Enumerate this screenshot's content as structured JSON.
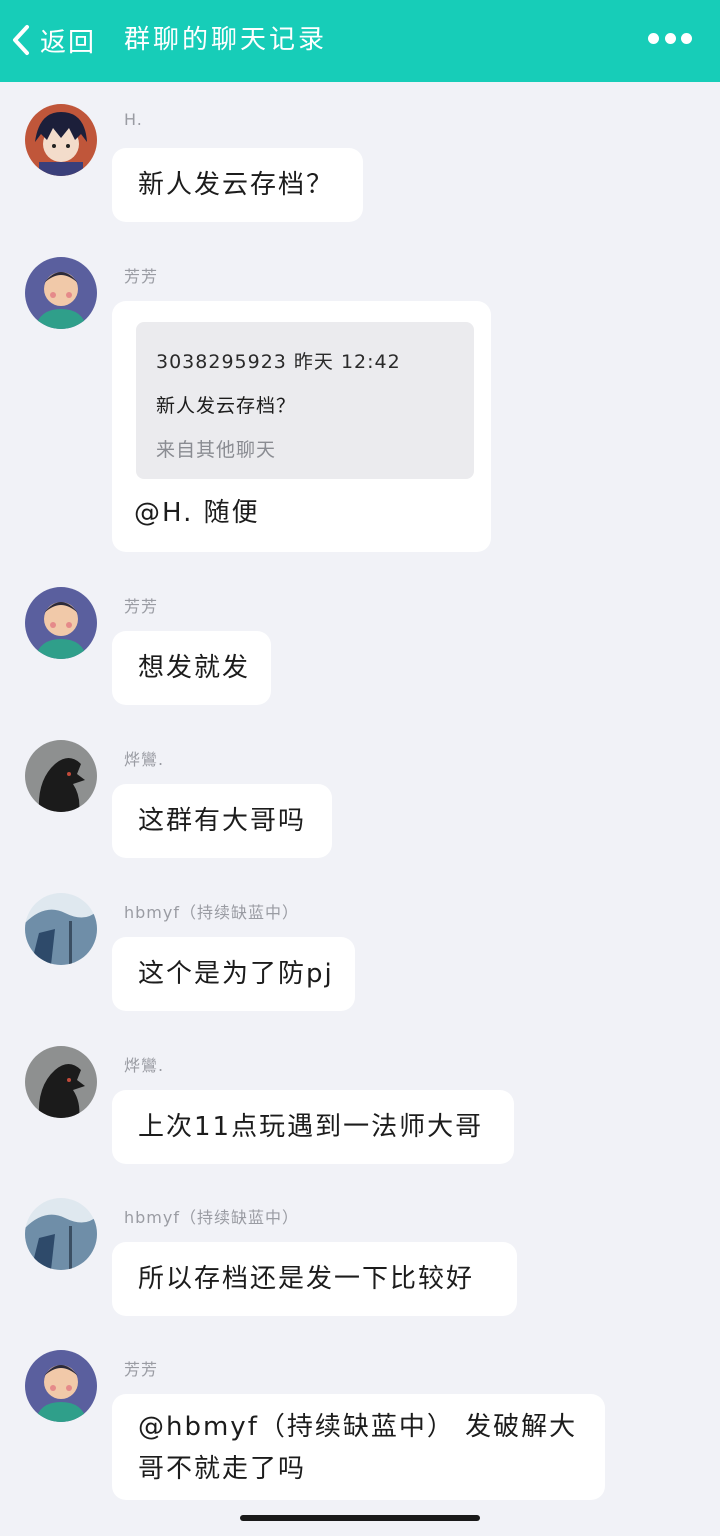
{
  "header": {
    "back_label": "返回",
    "title": "群聊的聊天记录",
    "back_icon": "chevron-left-icon",
    "more_icon": "more-dots-icon"
  },
  "colors": {
    "header_bg": "#17cdb8",
    "page_bg": "#f1f2f7",
    "bubble_bg": "#ffffff",
    "quote_bg": "#ebebee"
  },
  "messages": [
    {
      "sender": "H.",
      "text": "新人发云存档？"
    },
    {
      "sender": "芳芳",
      "quote": {
        "meta": "3038295923 昨天 12:42",
        "text": "新人发云存档？",
        "source": "来自其他聊天"
      },
      "text": "@H. 随便"
    },
    {
      "sender": "芳芳",
      "text": "想发就发"
    },
    {
      "sender": "烨鸞.",
      "text": "这群有大哥吗"
    },
    {
      "sender": "hbmyf（持续缺蓝中）",
      "text": "这个是为了防pj"
    },
    {
      "sender": "烨鸞.",
      "text": "上次11点玩遇到一法师大哥"
    },
    {
      "sender": "hbmyf（持续缺蓝中）",
      "text": "所以存档还是发一下比较好"
    },
    {
      "sender": "芳芳",
      "text": "@hbmyf（持续缺蓝中） 发破解大哥不就走了吗"
    }
  ]
}
